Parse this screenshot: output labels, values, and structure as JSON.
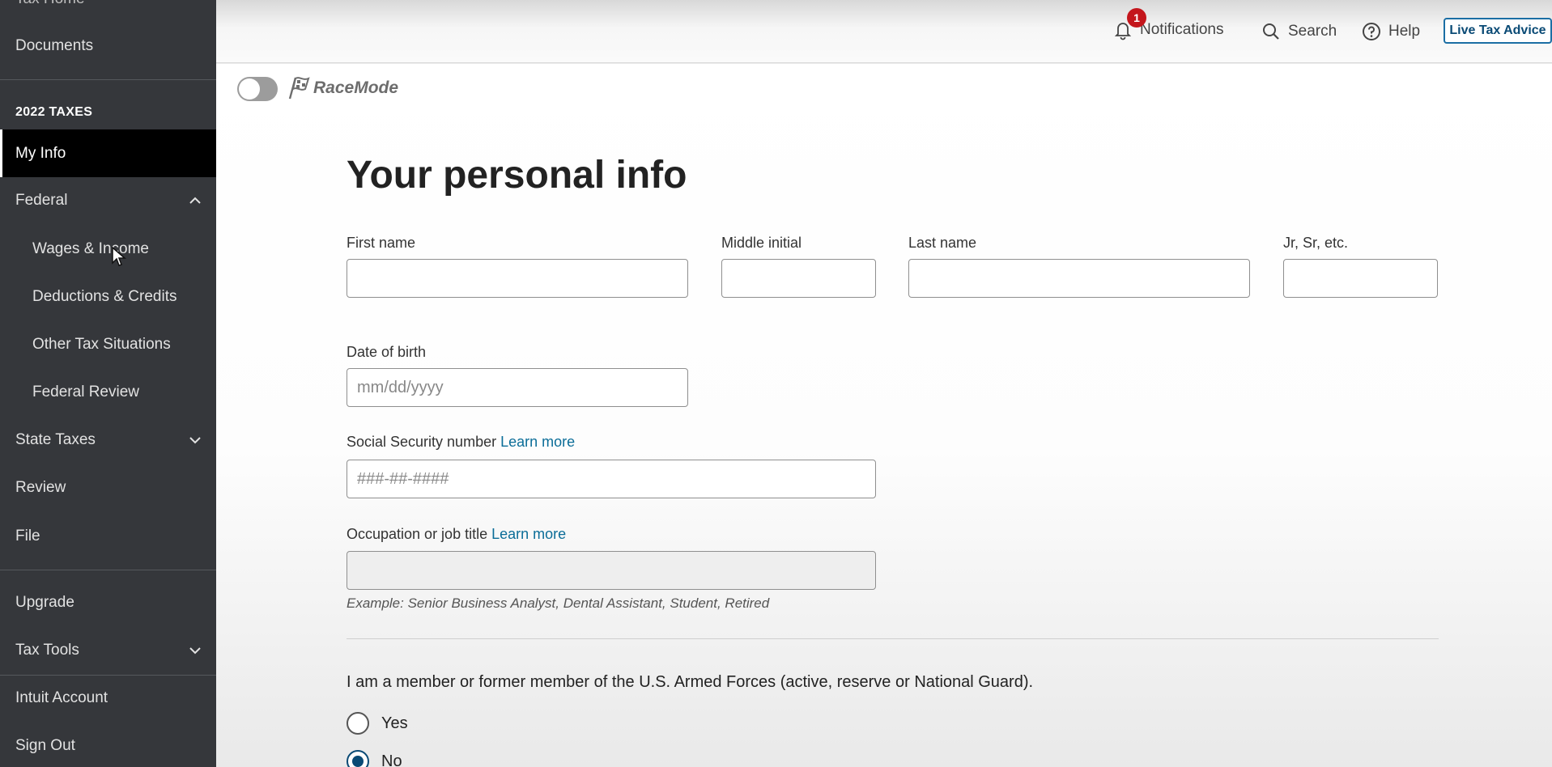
{
  "sidebar": {
    "top_cut_label": "Tax Home",
    "documents": "Documents",
    "section_title": "2022 TAXES",
    "my_info": "My Info",
    "federal": "Federal",
    "federal_sub": [
      "Wages & Income",
      "Deductions & Credits",
      "Other Tax Situations",
      "Federal Review"
    ],
    "state_taxes": "State Taxes",
    "review": "Review",
    "file": "File",
    "upgrade": "Upgrade",
    "tax_tools": "Tax Tools",
    "intuit_account": "Intuit Account",
    "sign_out": "Sign Out"
  },
  "header": {
    "notifications": "Notifications",
    "notifications_count": "1",
    "search": "Search",
    "help": "Help",
    "live_tax_advice": "Live Tax Advice"
  },
  "racemode": {
    "label": "RaceMode",
    "enabled": false
  },
  "form": {
    "title": "Your personal info",
    "first_name_label": "First name",
    "middle_initial_label": "Middle initial",
    "last_name_label": "Last name",
    "suffix_label": "Jr, Sr, etc.",
    "dob_label": "Date of birth",
    "dob_placeholder": "mm/dd/yyyy",
    "ssn_label": "Social Security number",
    "ssn_learn_more": "Learn more",
    "ssn_placeholder": "###-##-####",
    "occupation_label": "Occupation or job title",
    "occupation_learn_more": "Learn more",
    "occupation_hint": "Example: Senior Business Analyst, Dental Assistant, Student, Retired",
    "armed_forces_question": "I am a member or former member of the U.S. Armed Forces (active, reserve or National Guard).",
    "armed_forces_options": [
      "Yes",
      "No"
    ],
    "armed_forces_selected": "No"
  }
}
